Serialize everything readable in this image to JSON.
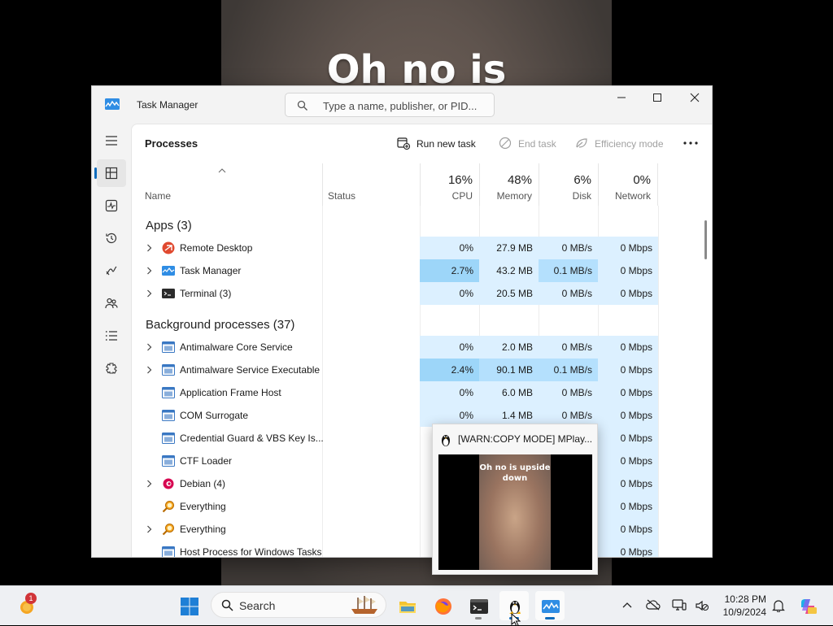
{
  "background_video": {
    "caption": "Oh no is"
  },
  "window": {
    "title": "Task Manager",
    "search_placeholder": "Type a name, publisher, or PID..."
  },
  "page": {
    "title": "Processes"
  },
  "commands": {
    "run_new_task": "Run new task",
    "end_task": "End task",
    "efficiency_mode": "Efficiency mode"
  },
  "columns": {
    "name": "Name",
    "status": "Status",
    "cpu": {
      "pct": "16%",
      "label": "CPU"
    },
    "memory": {
      "pct": "48%",
      "label": "Memory"
    },
    "disk": {
      "pct": "6%",
      "label": "Disk"
    },
    "network": {
      "pct": "0%",
      "label": "Network"
    }
  },
  "groups": {
    "apps": "Apps (3)",
    "background": "Background processes (37)"
  },
  "apps": [
    {
      "name": "Remote Desktop",
      "icon": "remote-desktop-icon",
      "expand": true,
      "cpu": "0%",
      "memory": "27.9 MB",
      "disk": "0 MB/s",
      "network": "0 Mbps"
    },
    {
      "name": "Task Manager",
      "icon": "task-manager-icon",
      "expand": true,
      "cpu": "2.7%",
      "memory": "43.2 MB",
      "disk": "0.1 MB/s",
      "network": "0 Mbps"
    },
    {
      "name": "Terminal (3)",
      "icon": "terminal-icon",
      "expand": true,
      "cpu": "0%",
      "memory": "20.5 MB",
      "disk": "0 MB/s",
      "network": "0 Mbps"
    }
  ],
  "background": [
    {
      "name": "Antimalware Core Service",
      "icon": "service-icon",
      "expand": true,
      "cpu": "0%",
      "memory": "2.0 MB",
      "disk": "0 MB/s",
      "network": "0 Mbps"
    },
    {
      "name": "Antimalware Service Executable",
      "icon": "service-icon",
      "expand": true,
      "cpu": "2.4%",
      "memory": "90.1 MB",
      "disk": "0.1 MB/s",
      "network": "0 Mbps"
    },
    {
      "name": "Application Frame Host",
      "icon": "service-icon",
      "expand": false,
      "cpu": "0%",
      "memory": "6.0 MB",
      "disk": "0 MB/s",
      "network": "0 Mbps"
    },
    {
      "name": "COM Surrogate",
      "icon": "service-icon",
      "expand": false,
      "cpu": "0%",
      "memory": "1.4 MB",
      "disk": "0 MB/s",
      "network": "0 Mbps"
    },
    {
      "name": "Credential Guard & VBS Key Is...",
      "icon": "service-icon",
      "expand": false,
      "cpu": "",
      "memory": "",
      "disk": "",
      "network": "0 Mbps"
    },
    {
      "name": "CTF Loader",
      "icon": "service-icon",
      "expand": false,
      "cpu": "",
      "memory": "",
      "disk": "",
      "network": "0 Mbps"
    },
    {
      "name": "Debian (4)",
      "icon": "debian-icon",
      "expand": true,
      "cpu": "",
      "memory": "",
      "disk": "",
      "network": "0 Mbps"
    },
    {
      "name": "Everything",
      "icon": "everything-icon",
      "expand": false,
      "cpu": "",
      "memory": "",
      "disk": "",
      "network": "0 Mbps"
    },
    {
      "name": "Everything",
      "icon": "everything-icon",
      "expand": true,
      "cpu": "",
      "memory": "",
      "disk": "",
      "network": "0 Mbps"
    },
    {
      "name": "Host Process for Windows Tasks",
      "icon": "service-icon",
      "expand": false,
      "cpu": "",
      "memory": "",
      "disk": "",
      "network": "0 Mbps"
    }
  ],
  "preview": {
    "title": "[WARN:COPY MODE] MPlay...",
    "caption": "Oh no is upside down"
  },
  "taskbar": {
    "search_label": "Search",
    "time": "10:28 PM",
    "date": "10/9/2024",
    "weather_badge": "1"
  },
  "colors": {
    "accent": "#0f6cbd",
    "heat_low": "#dcf0ff",
    "heat_mid": "#b4e0fd",
    "heat_high": "#9dd6f9"
  }
}
